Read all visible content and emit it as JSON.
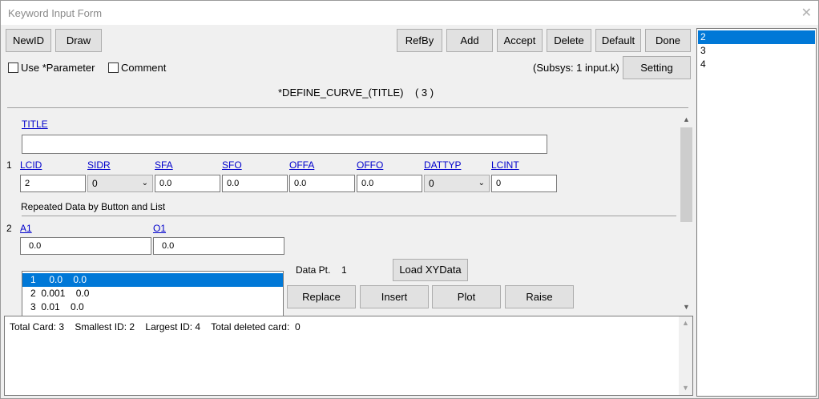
{
  "window": {
    "title": "Keyword Input Form",
    "close_glyph": "✕"
  },
  "toolbar": {
    "newid": "NewID",
    "draw": "Draw",
    "refby": "RefBy",
    "add": "Add",
    "accept": "Accept",
    "delete": "Delete",
    "default": "Default",
    "done": "Done",
    "setting": "Setting"
  },
  "options": {
    "use_parameter": "Use *Parameter",
    "comment": "Comment"
  },
  "subsys": "(Subsys: 1 input.k)",
  "keyword_heading": "*DEFINE_CURVE_(TITLE)    ( 3 )",
  "card0": {
    "title_label": "TITLE",
    "title_value": ""
  },
  "card1": {
    "number": "1",
    "fields": [
      {
        "label": "LCID",
        "value": "2"
      },
      {
        "label": "SIDR",
        "value": "0"
      },
      {
        "label": "SFA",
        "value": "0.0"
      },
      {
        "label": "SFO",
        "value": "0.0"
      },
      {
        "label": "OFFA",
        "value": "0.0"
      },
      {
        "label": "OFFO",
        "value": "0.0"
      },
      {
        "label": "DATTYP",
        "value": "0"
      },
      {
        "label": "LCINT",
        "value": "0"
      }
    ]
  },
  "repeated_heading": "Repeated Data by Button and List",
  "card2": {
    "number": "2",
    "a1_label": "A1",
    "a1_value": "0.0",
    "o1_label": "O1",
    "o1_value": "0.0"
  },
  "data_list": [
    "   1     0.0    0.0",
    "   2  0.001    0.0",
    "   3  0.01    0.0"
  ],
  "data_pt_label": "Data Pt.",
  "data_pt_value": "1",
  "actions": {
    "load": "Load XYData",
    "replace": "Replace",
    "insert": "Insert",
    "plot": "Plot",
    "raise": "Raise"
  },
  "status_text": "Total Card: 3    Smallest ID: 2    Largest ID: 4    Total deleted card:  0",
  "id_list": [
    "2",
    "3",
    "4"
  ],
  "colors": {
    "selection": "#0078d7",
    "link": "#0000cc"
  }
}
